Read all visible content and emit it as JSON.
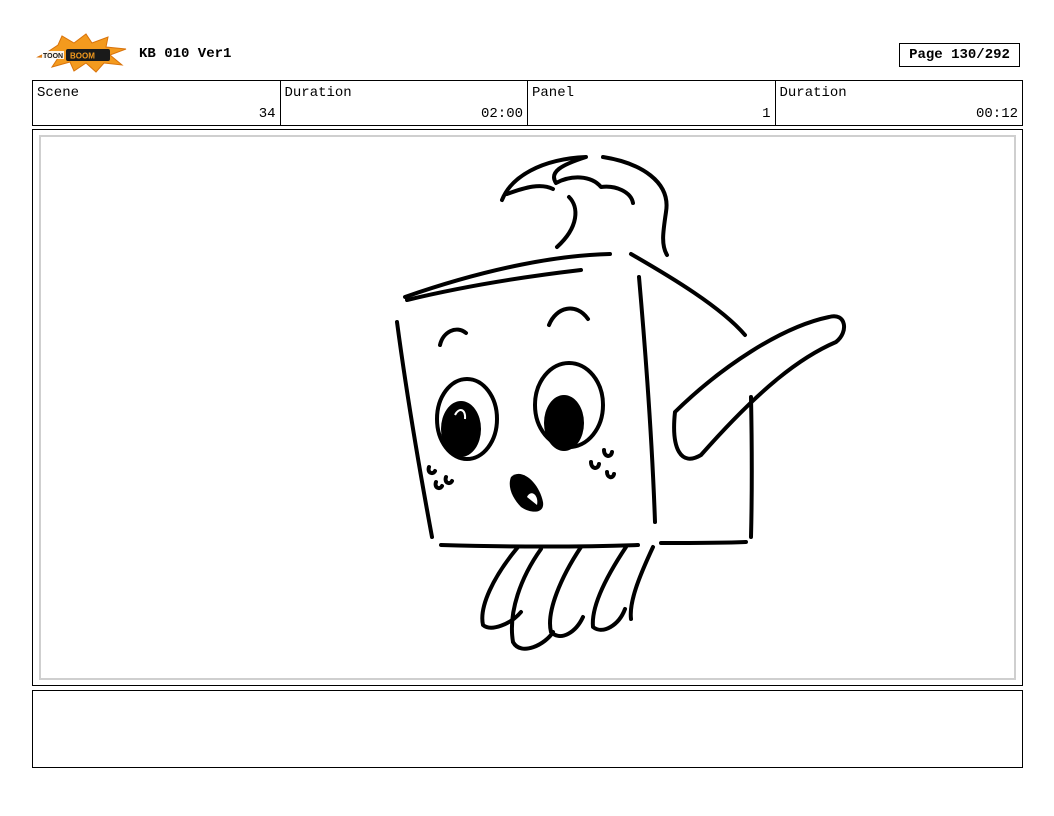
{
  "header": {
    "logo_text": "TOON BOOM",
    "doc_title": "KB 010 Ver1",
    "page_label": "Page 130/292"
  },
  "info": {
    "scene_label": "Scene",
    "scene_value": "34",
    "scene_duration_label": "Duration",
    "scene_duration_value": "02:00",
    "panel_label": "Panel",
    "panel_value": "1",
    "panel_duration_label": "Duration",
    "panel_duration_value": "00:12"
  },
  "colors": {
    "logo_burst": "#f39a1e",
    "logo_badge": "#1a1a1a",
    "frame_border": "#000000",
    "inner_frame": "#cfcfcf"
  },
  "notes": {
    "text": ""
  }
}
